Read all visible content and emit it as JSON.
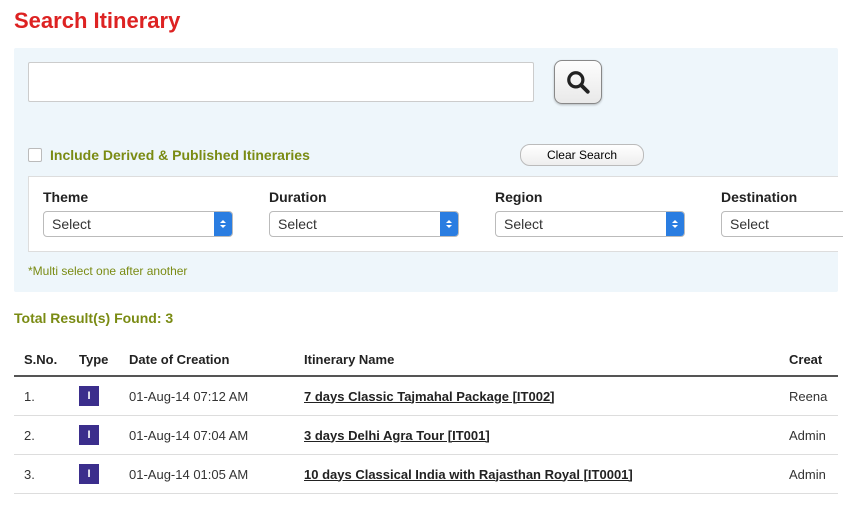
{
  "title": "Search Itinerary",
  "search": {
    "value": "",
    "placeholder": ""
  },
  "include_derived_label": "Include Derived & Published Itineraries",
  "clear_search_label": "Clear Search",
  "filters": {
    "theme": {
      "label": "Theme",
      "selected": "Select"
    },
    "duration": {
      "label": "Duration",
      "selected": "Select"
    },
    "region": {
      "label": "Region",
      "selected": "Select"
    },
    "destination": {
      "label": "Destination",
      "selected": "Select"
    }
  },
  "multi_select_hint": "*Multi select one after another",
  "total_results_label": "Total Result(s) Found: 3",
  "columns": {
    "sno": "S.No.",
    "type": "Type",
    "date": "Date of Creation",
    "name": "Itinerary Name",
    "creator": "Creat"
  },
  "rows": [
    {
      "sno": "1.",
      "type": "I",
      "date": "01-Aug-14 07:12 AM",
      "name": "7 days Classic Tajmahal Package [IT002]",
      "creator": "Reena"
    },
    {
      "sno": "2.",
      "type": "I",
      "date": "01-Aug-14 07:04 AM",
      "name": "3 days Delhi Agra Tour [IT001]",
      "creator": "Admin"
    },
    {
      "sno": "3.",
      "type": "I",
      "date": "01-Aug-14 01:05 AM",
      "name": "10 days Classical India with Rajasthan Royal [IT0001]",
      "creator": "Admin"
    }
  ]
}
